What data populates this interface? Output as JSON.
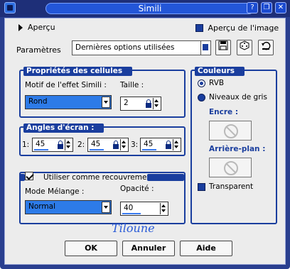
{
  "window": {
    "title": "Simili"
  },
  "titlebar": {
    "help": "?",
    "restore": "❐",
    "close": "✕"
  },
  "preview": {
    "label": "Aperçu",
    "image_preview_label": "Aperçu de l'image"
  },
  "params": {
    "label": "Paramètres",
    "value": "Dernières options utilisées"
  },
  "cell_props": {
    "title": "Propriétés des cellules",
    "effect_label": "Motif de l'effet Simili :",
    "effect_value": "Rond",
    "size_label": "Taille :",
    "size_value": "2"
  },
  "angles": {
    "title": "Angles d'écran :",
    "fields": [
      {
        "label": "1:",
        "value": "45"
      },
      {
        "label": "2:",
        "value": "45"
      },
      {
        "label": "3:",
        "value": "45"
      }
    ]
  },
  "overlay": {
    "label": "Utiliser comme recouvrement",
    "checked": true,
    "blend_label": "Mode Mélange :",
    "blend_value": "Normal",
    "opacity_label": "Opacité :",
    "opacity_value": "40"
  },
  "colors": {
    "title": "Couleurs",
    "rgb_label": "RVB",
    "gray_label": "Niveaux de gris",
    "ink_label": "Encre :",
    "bg_label": "Arrière-plan :",
    "transparent_label": "Transparent"
  },
  "signature": "Tiloune",
  "buttons": {
    "ok": "OK",
    "cancel": "Annuler",
    "help": "Aide"
  },
  "theme": {
    "accent": "#1a3e9e",
    "frame": "#2a3f8f",
    "client": "#ececec"
  }
}
